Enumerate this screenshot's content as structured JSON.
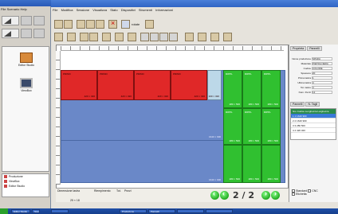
{
  "left_app": {
    "title": "",
    "menu": [
      "File",
      "Scenario",
      "Help"
    ],
    "icons": [
      {
        "label": "Editor Studio",
        "icon": "folder-icon"
      },
      {
        "label": "ViewBox",
        "icon": "monitor-icon"
      }
    ],
    "bottom_items": [
      "Produzione",
      "ViewBox",
      "Editor Studio"
    ]
  },
  "main_app": {
    "title": "",
    "menu": [
      "File",
      "Modifica",
      "Sessione",
      "Visualizza",
      "Stato",
      "Dispositivi",
      "Strumenti",
      "Informazioni"
    ],
    "toolbar_label": "rotate",
    "red_tiles": [
      {
        "label": "PRIMO",
        "dim": "420 × 320"
      },
      {
        "label": "PRIMO",
        "dim": "420 × 320"
      },
      {
        "label": "PRIMO",
        "dim": "420 × 320"
      },
      {
        "label": "PRIMO",
        "dim": "420 × 320"
      }
    ],
    "light_tile": {
      "dim": "100 × 320"
    },
    "board_dims": [
      "1640 × 900",
      "1640 × 900"
    ],
    "green_tiles": {
      "label": "RIPPL",
      "dim": "280 × 500"
    },
    "status": {
      "field1_label": "Dimensione lastra",
      "field2_label": "Riempimento",
      "field3_label": "Tot.",
      "field4_label": "Pezzi",
      "coords": "25 × 18"
    },
    "pagination": {
      "current": "2",
      "separator": "/",
      "total": "2"
    }
  },
  "right_panel": {
    "tabs": [
      "Proprieta",
      "Pannelli"
    ],
    "fields": [
      {
        "key": "Nome produzione",
        "value": "SPADA"
      },
      {
        "key": "Materiale",
        "value": "PIETRA NERA"
      },
      {
        "key": "Codice",
        "value": "COLORE"
      },
      {
        "key": "Spessore",
        "value": "20"
      },
      {
        "key": "Prima lastra",
        "value": "1"
      },
      {
        "key": "Ultima lastra",
        "value": "4"
      },
      {
        "key": "Tot. lastre",
        "value": "4"
      },
      {
        "key": "Num. Pezzi",
        "value": "12"
      }
    ],
    "table_tabs": [
      "Pannelli",
      "N. Tagli"
    ],
    "table_header": [
      "Nro",
      "Codice",
      "Lunghezza",
      "Larghezza"
    ],
    "table_rows": [
      [
        "1",
        "1",
        "1640",
        "900"
      ],
      [
        "2",
        "2",
        "1640",
        "900"
      ],
      [
        "3",
        "3",
        "280",
        "500"
      ],
      [
        "4",
        "4",
        "420",
        "320"
      ]
    ],
    "checks": [
      "Standard",
      "Etichetta",
      "CNC"
    ]
  },
  "taskbar": {
    "items": [
      "Editor Studio",
      "Scenario",
      "",
      "Produzione",
      "Pannelli",
      "",
      ""
    ]
  }
}
